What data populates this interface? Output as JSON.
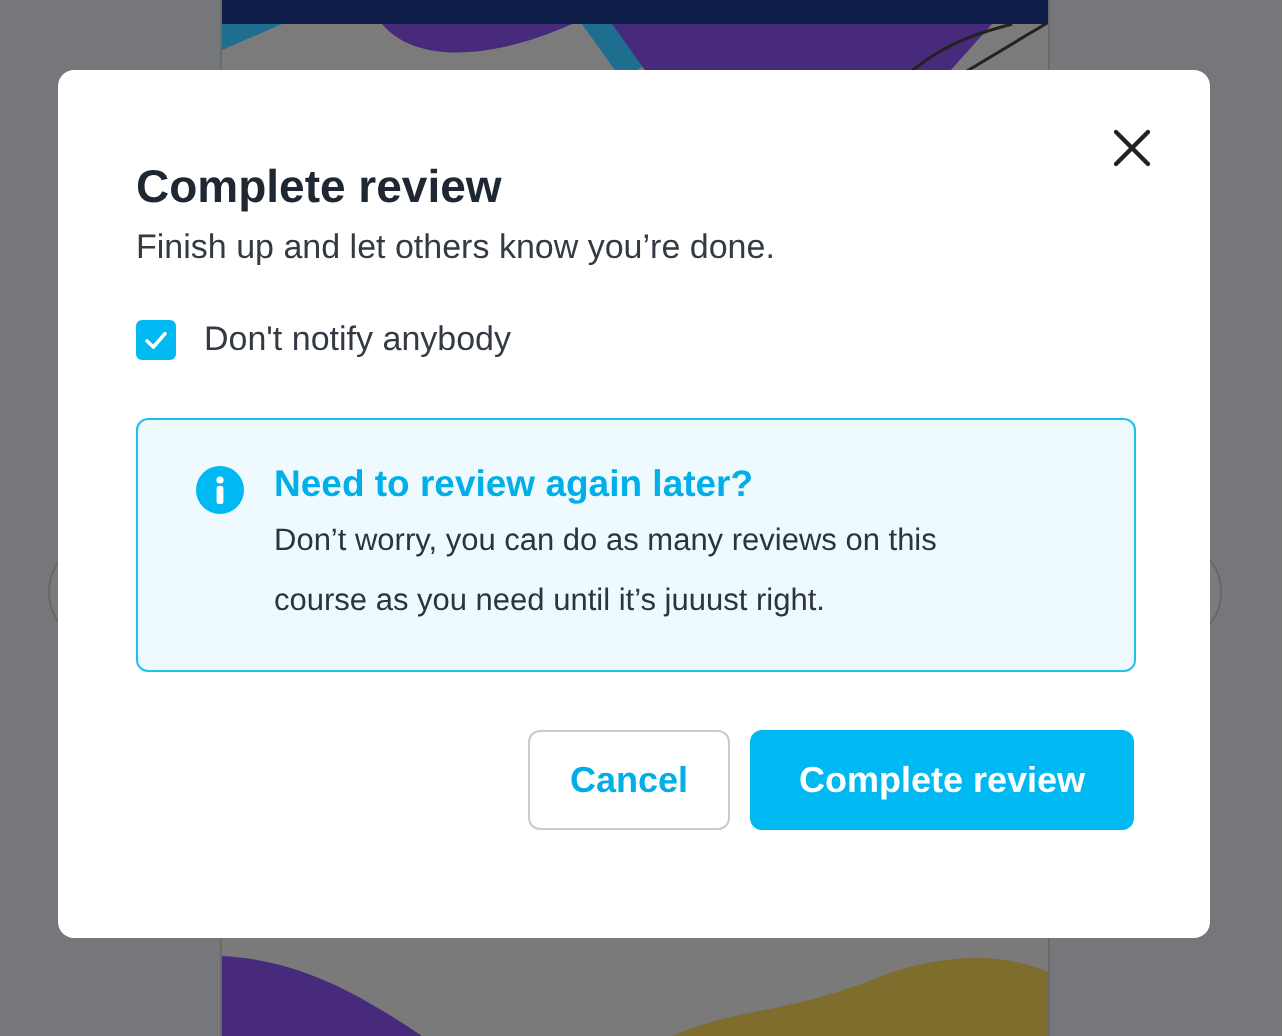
{
  "dialog": {
    "title": "Complete review",
    "subtitle": "Finish up and let others know you’re done.",
    "checkbox": {
      "label": "Don't notify anybody",
      "checked": true
    },
    "notice": {
      "title": "Need to review again later?",
      "body": "Don’t worry, you can do as many reviews on this course as you need until it’s juuust right."
    },
    "buttons": [
      {
        "label": "Cancel",
        "kind": "secondary"
      },
      {
        "label": "Complete review",
        "kind": "primary"
      }
    ]
  }
}
